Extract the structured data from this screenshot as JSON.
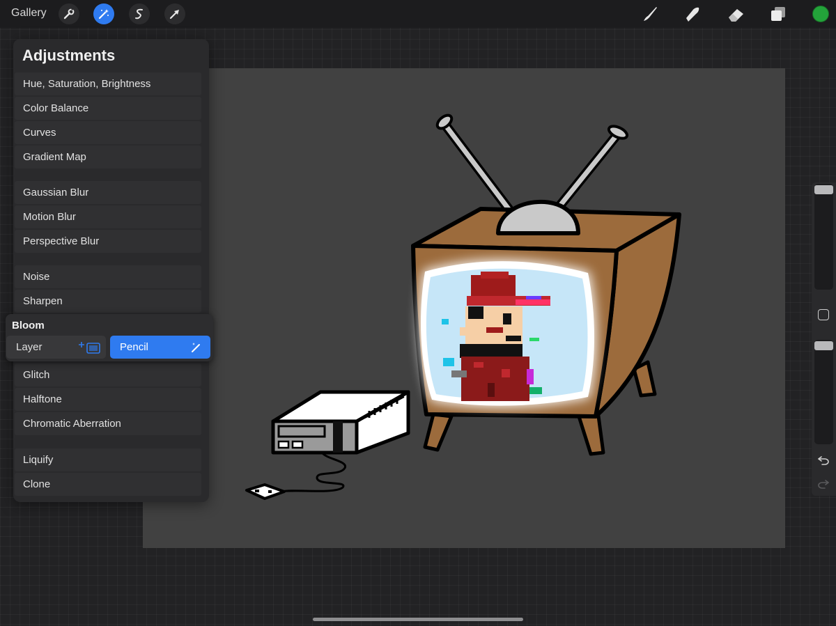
{
  "topbar": {
    "gallery_label": "Gallery",
    "left_tools": [
      "wrench-icon",
      "magic-wand-icon",
      "selection-icon",
      "transform-arrow-icon"
    ],
    "active_tool": "magic-wand-icon",
    "right_tools": [
      "brush-icon",
      "smudge-icon",
      "eraser-icon",
      "layers-icon"
    ],
    "current_color": "#23a33a"
  },
  "adjustments": {
    "title": "Adjustments",
    "groups": [
      [
        "Hue, Saturation, Brightness",
        "Color Balance",
        "Curves",
        "Gradient Map"
      ],
      [
        "Gaussian Blur",
        "Motion Blur",
        "Perspective Blur"
      ],
      [
        "Noise",
        "Sharpen"
      ],
      [
        "Bloom",
        "Glitch",
        "Halftone",
        "Chromatic Aberration"
      ],
      [
        "Liquify",
        "Clone"
      ]
    ]
  },
  "bloom_popover": {
    "title": "Bloom",
    "options": [
      "Layer",
      "Pencil"
    ],
    "selected": "Pencil"
  },
  "sidebar": {
    "brush_size_level": 0.05,
    "opacity_level": 0.05
  },
  "colors": {
    "accent": "#2f7bf0",
    "panel": "#2a2a2c",
    "canvas": "#414141",
    "tv_wood": "#9c6b3c",
    "tv_screen": "#c6e6f8"
  }
}
